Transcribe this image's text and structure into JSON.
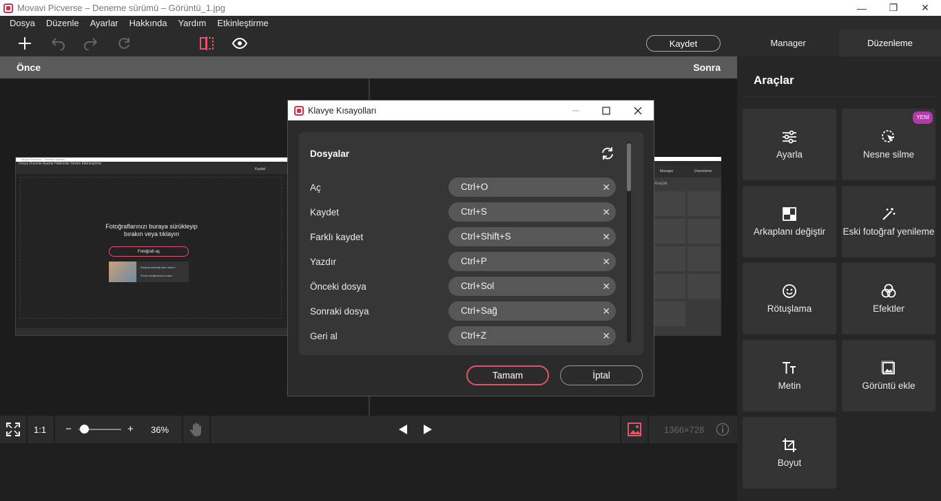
{
  "window": {
    "title": "Movavi Picverse – Deneme sürümü – Görüntü_1.jpg",
    "minimize": "—",
    "maximize": "❐",
    "close": "✕"
  },
  "menu": [
    "Dosya",
    "Düzenle",
    "Ayarlar",
    "Hakkında",
    "Yardım",
    "Etkinleştirme"
  ],
  "toolbar": {
    "save_label": "Kaydet",
    "tab_manager": "Manager",
    "tab_edit": "Düzenleme"
  },
  "compare": {
    "before": "Önce",
    "after": "Sonra"
  },
  "bottombar": {
    "ratio": "1:1",
    "zoom_minus": "−",
    "zoom_plus": "+",
    "zoom_percent": "36%",
    "zoom_fraction": 0.05,
    "dimensions": "1366×728"
  },
  "tools_panel": {
    "title": "Araçlar",
    "new_badge": "YENİ",
    "tools": [
      {
        "label": "Ayarla",
        "icon": "sliders-icon"
      },
      {
        "label": "Nesne silme",
        "icon": "object-erase-icon"
      },
      {
        "label": "Arkaplanı değiştir",
        "icon": "background-icon"
      },
      {
        "label": "Eski fotoğraf yenileme",
        "icon": "magic-wand-icon"
      },
      {
        "label": "Rötuşlama",
        "icon": "face-icon"
      },
      {
        "label": "Efektler",
        "icon": "effects-icon"
      },
      {
        "label": "Metin",
        "icon": "text-icon"
      },
      {
        "label": "Görüntü ekle",
        "icon": "add-image-icon"
      },
      {
        "label": "Boyut",
        "icon": "crop-icon"
      }
    ]
  },
  "dialog": {
    "title": "Klavye Kısayolları",
    "section": "Dosyalar",
    "shortcuts": [
      {
        "action": "Aç",
        "keys": "Ctrl+O"
      },
      {
        "action": "Kaydet",
        "keys": "Ctrl+S"
      },
      {
        "action": "Farklı kaydet",
        "keys": "Ctrl+Shift+S"
      },
      {
        "action": "Yazdır",
        "keys": "Ctrl+P"
      },
      {
        "action": "Önceki dosya",
        "keys": "Ctrl+Sol"
      },
      {
        "action": "Sonraki dosya",
        "keys": "Ctrl+Sağ"
      },
      {
        "action": "Geri al",
        "keys": "Ctrl+Z"
      }
    ],
    "clear_glyph": "✕",
    "ok_label": "Tamam",
    "cancel_label": "İptal"
  },
  "mini_preview": {
    "title": "Movavi Picverse – Deneme sürümü",
    "menu": "Dosya   Düzenle   Ayarlar   Hakkında   Yardım   Etkinleştirme",
    "save": "Kaydet",
    "drop_text_1": "Fotoğraflarınızı buraya sürükleyip",
    "drop_text_2": "bırakın veya tıklayın",
    "open_photo": "Fotoğrafı aç",
    "sample_1": "Etrafına bakmak ister misin?",
    "sample_2": "Örnek fotoğrafımızı kullan",
    "manager": "Manager",
    "edit": "Düzenleme",
    "tools": "Araçlar"
  }
}
